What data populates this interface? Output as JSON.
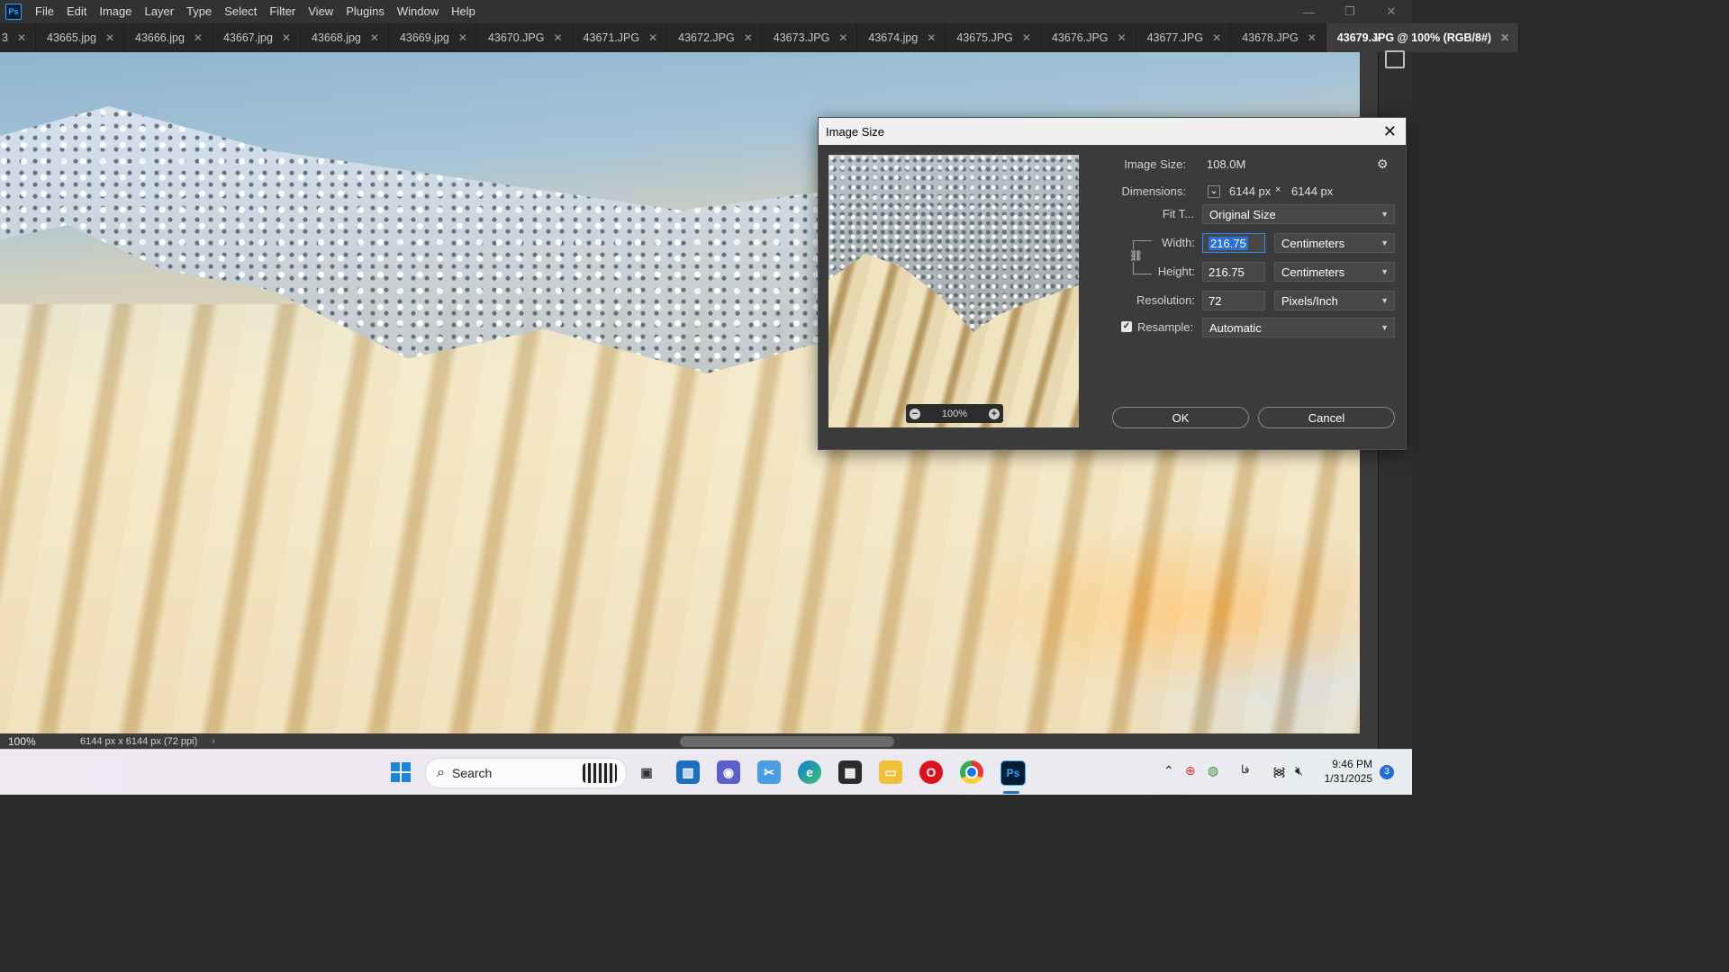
{
  "menubar": {
    "app_icon": "Ps",
    "items": [
      "File",
      "Edit",
      "Image",
      "Layer",
      "Type",
      "Select",
      "Filter",
      "View",
      "Plugins",
      "Window",
      "Help"
    ]
  },
  "tabs": {
    "items": [
      "3",
      "43665.jpg",
      "43666.jpg",
      "43667.jpg",
      "43668.jpg",
      "43669.jpg",
      "43670.JPG",
      "43671.JPG",
      "43672.JPG",
      "43673.JPG",
      "43674.jpg",
      "43675.JPG",
      "43676.JPG",
      "43677.JPG",
      "43678.JPG"
    ],
    "active": "43679.JPG @ 100% (RGB/8#)",
    "overflow": "»"
  },
  "status": {
    "zoom": "100%",
    "doc_info": "6144 px x 6144 px (72 ppi)",
    "arrow": "›"
  },
  "dialog": {
    "title": "Image Size",
    "close": "✕",
    "image_size_label": "Image Size:",
    "image_size_value": "108.0M",
    "dimensions_label": "Dimensions:",
    "dim_w": "6144 px",
    "dim_x": "×",
    "dim_h": "6144 px",
    "fit_label": "Fit T...",
    "fit_value": "Original Size",
    "width_label": "Width:",
    "width_value": "216.75",
    "width_unit": "Centimeters",
    "height_label": "Height:",
    "height_value": "216.75",
    "height_unit": "Centimeters",
    "resolution_label": "Resolution:",
    "resolution_value": "72",
    "resolution_unit": "Pixels/Inch",
    "resample_label": "Resample:",
    "resample_checked": true,
    "resample_value": "Automatic",
    "preview_zoom": "100%",
    "ok": "OK",
    "cancel": "Cancel"
  },
  "taskbar": {
    "search_label": "Search",
    "time": "9:46 PM",
    "date": "1/31/2025",
    "notifications": "3",
    "lang": "فا"
  },
  "colors": {
    "accent": "#2d6fd6",
    "ps_blue": "#31a8ff",
    "dialog_bg": "#3b3b3b"
  }
}
